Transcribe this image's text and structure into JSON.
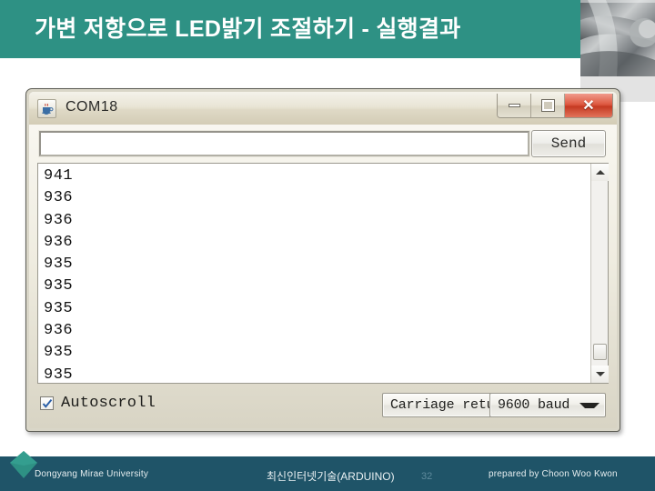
{
  "slide": {
    "header": {
      "title": "가변 저항으로 LED밝기 조절하기 - 실행결과",
      "band_color": "#2e9184"
    },
    "footer": {
      "left": "Dongyang Mirae University",
      "center": "최신인터넷기술(ARDUINO)",
      "page_number": "32",
      "right": "prepared by Choon Woo Kwon",
      "bar_color": "#1f5468",
      "logo_color": "#2e9184"
    }
  },
  "serial_monitor": {
    "title": "COM18",
    "title_icon": "java-coffee-cup-icon",
    "window_buttons": {
      "minimize": "minimize-icon",
      "maximize": "maximize-icon",
      "close": "close-icon"
    },
    "send_field": {
      "value": "",
      "placeholder": ""
    },
    "send_button": "Send",
    "console_lines": [
      "941",
      "936",
      "936",
      "936",
      "935",
      "935",
      "935",
      "936",
      "935",
      "935"
    ],
    "scrollbar": {
      "up_arrow": "scroll-up-icon",
      "down_arrow": "scroll-down-icon"
    },
    "autoscroll": {
      "label": "Autoscroll",
      "checked": true
    },
    "line_ending": {
      "selected": "Carriage return"
    },
    "baud_rate": {
      "selected": "9600 baud"
    }
  }
}
